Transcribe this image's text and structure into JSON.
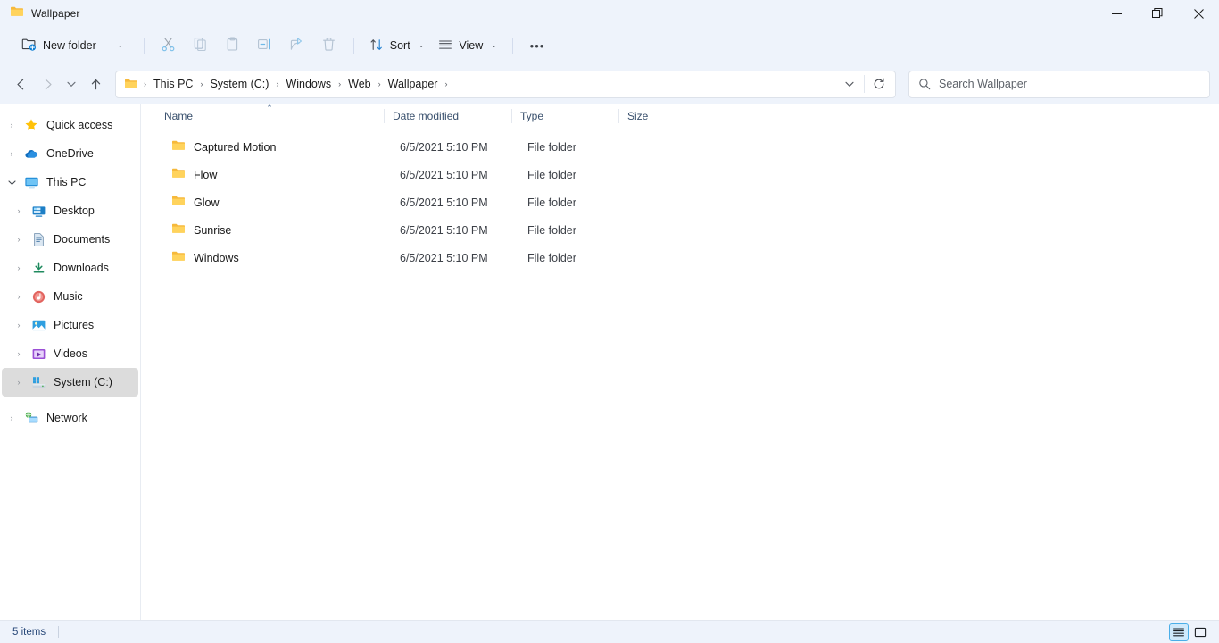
{
  "window": {
    "title": "Wallpaper",
    "title_icon": "folder-icon",
    "minimize_label": "─",
    "maximize_label": "❐",
    "close_label": "✕"
  },
  "toolbar": {
    "new_folder_label": "New folder",
    "new_folder_caret": "⌄",
    "cut_name": "cut-icon",
    "copy_name": "copy-icon",
    "paste_name": "paste-icon",
    "rename_name": "rename-icon",
    "share_name": "share-icon",
    "delete_name": "delete-icon",
    "sort_label": "Sort",
    "sort_caret": "⌄",
    "view_label": "View",
    "view_caret": "⌄",
    "more_label": "•••"
  },
  "nav": {
    "back_label": "←",
    "forward_label": "→",
    "recent_label": "⌄",
    "up_label": "↑",
    "breadcrumbs": [
      {
        "label": "This PC"
      },
      {
        "label": "System (C:)"
      },
      {
        "label": "Windows"
      },
      {
        "label": "Web"
      },
      {
        "label": "Wallpaper"
      }
    ],
    "separator": "›",
    "address_caret": "⌄",
    "refresh_label": "↻"
  },
  "search": {
    "placeholder": "Search Wallpaper",
    "value": "",
    "icon": "search-icon"
  },
  "sidebar": {
    "items": [
      {
        "label": "Quick access",
        "icon": "star-icon",
        "chevron": "›",
        "expanded": false,
        "selected": false,
        "depth": 0
      },
      {
        "label": "OneDrive",
        "icon": "cloud-icon",
        "chevron": "›",
        "expanded": false,
        "selected": false,
        "depth": 0
      },
      {
        "label": "This PC",
        "icon": "monitor-icon",
        "chevron": "⌄",
        "expanded": true,
        "selected": false,
        "depth": 0
      },
      {
        "label": "Desktop",
        "icon": "desktop-icon",
        "chevron": "›",
        "expanded": false,
        "selected": false,
        "depth": 1
      },
      {
        "label": "Documents",
        "icon": "documents-icon",
        "chevron": "›",
        "expanded": false,
        "selected": false,
        "depth": 1
      },
      {
        "label": "Downloads",
        "icon": "download-icon",
        "chevron": "›",
        "expanded": false,
        "selected": false,
        "depth": 1
      },
      {
        "label": "Music",
        "icon": "music-icon",
        "chevron": "›",
        "expanded": false,
        "selected": false,
        "depth": 1
      },
      {
        "label": "Pictures",
        "icon": "pictures-icon",
        "chevron": "›",
        "expanded": false,
        "selected": false,
        "depth": 1
      },
      {
        "label": "Videos",
        "icon": "videos-icon",
        "chevron": "›",
        "expanded": false,
        "selected": false,
        "depth": 1
      },
      {
        "label": "System (C:)",
        "icon": "drive-icon",
        "chevron": "›",
        "expanded": false,
        "selected": true,
        "depth": 1
      },
      {
        "label": "Network",
        "icon": "network-icon",
        "chevron": "›",
        "expanded": false,
        "selected": false,
        "depth": 0
      }
    ]
  },
  "filelist": {
    "columns": [
      {
        "label": "Name",
        "sorted": true,
        "sort_caret": "⌃"
      },
      {
        "label": "Date modified",
        "sorted": false,
        "sort_caret": ""
      },
      {
        "label": "Type",
        "sorted": false,
        "sort_caret": ""
      },
      {
        "label": "Size",
        "sorted": false,
        "sort_caret": ""
      }
    ],
    "rows": [
      {
        "name": "Captured Motion",
        "date": "6/5/2021 5:10 PM",
        "type": "File folder",
        "size": "",
        "icon": "folder-icon"
      },
      {
        "name": "Flow",
        "date": "6/5/2021 5:10 PM",
        "type": "File folder",
        "size": "",
        "icon": "folder-icon"
      },
      {
        "name": "Glow",
        "date": "6/5/2021 5:10 PM",
        "type": "File folder",
        "size": "",
        "icon": "folder-icon"
      },
      {
        "name": "Sunrise",
        "date": "6/5/2021 5:10 PM",
        "type": "File folder",
        "size": "",
        "icon": "folder-icon"
      },
      {
        "name": "Windows",
        "date": "6/5/2021 5:10 PM",
        "type": "File folder",
        "size": "",
        "icon": "folder-icon"
      }
    ]
  },
  "statusbar": {
    "item_count": "5 items",
    "details_view_name": "details-view-icon",
    "large_icons_view_name": "large-icons-view-icon"
  },
  "colors": {
    "chrome": "#eef3fb",
    "content": "#ffffff",
    "folder_yellow": "#ffc43d",
    "accent_blue": "#0078d4",
    "selection_gray": "#dcdcdc",
    "header_text": "#39506d"
  }
}
